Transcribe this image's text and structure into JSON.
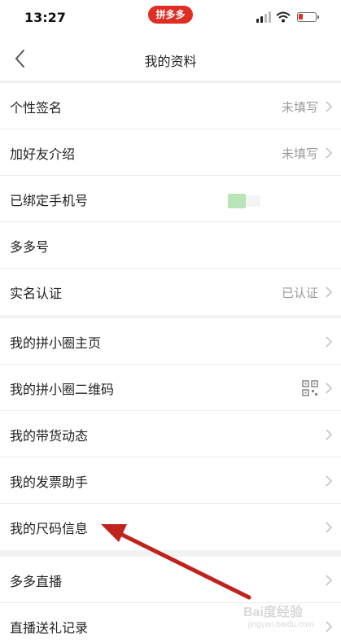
{
  "status": {
    "time": "13:27",
    "app_badge": "拼多多"
  },
  "nav": {
    "title": "我的资料"
  },
  "groups": [
    {
      "rows": [
        {
          "label": "个性签名",
          "value": "未填写"
        },
        {
          "label": "加好友介绍",
          "value": "未填写"
        },
        {
          "label": "已绑定手机号",
          "value": ""
        },
        {
          "label": "多多号",
          "value": ""
        },
        {
          "label": "实名认证",
          "value": "已认证"
        }
      ]
    },
    {
      "rows": [
        {
          "label": "我的拼小圈主页",
          "value": ""
        },
        {
          "label": "我的拼小圈二维码",
          "value": ""
        },
        {
          "label": "我的带货动态",
          "value": ""
        },
        {
          "label": "我的发票助手",
          "value": ""
        },
        {
          "label": "我的尺码信息",
          "value": ""
        }
      ]
    },
    {
      "rows": [
        {
          "label": "多多直播",
          "value": ""
        },
        {
          "label": "直播送礼记录",
          "value": ""
        }
      ]
    }
  ],
  "watermark": {
    "main": "Bai度经验",
    "sub": "jingyan.baidu.com"
  },
  "colors": {
    "brand": "#e02e24",
    "annotation_arrow": "#c0231c",
    "toggle_green": "#b9e6b6"
  },
  "icons": {
    "back": "chevron-left-icon",
    "row_arrow": "chevron-right-icon",
    "qr": "qr-code-icon"
  }
}
